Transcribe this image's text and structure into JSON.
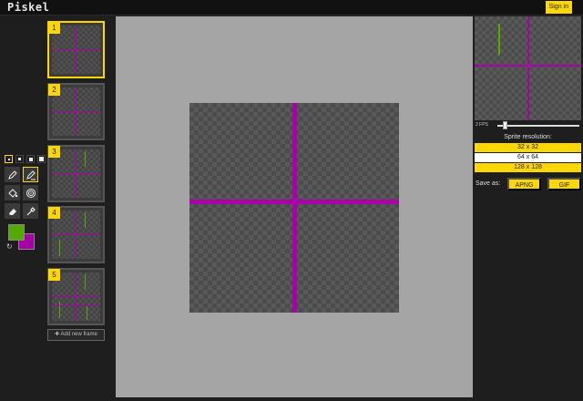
{
  "app": {
    "title": "Piskel",
    "signin_label": "Sign in"
  },
  "colors": {
    "accent": "#ffd700",
    "primary_color": "#55aa00",
    "secondary_color": "#aa00aa",
    "cross_color": "#aa00aa",
    "line_color": "#55aa00"
  },
  "tools": {
    "pen_sizes": [
      "pen-size-1",
      "pen-size-2",
      "pen-size-3",
      "pen-size-4"
    ],
    "items": [
      {
        "name": "pen-tool",
        "icon": "pencil-icon"
      },
      {
        "name": "vertical-mirror-pen-tool",
        "icon": "pencil-icon"
      },
      {
        "name": "paint-bucket-tool",
        "icon": "bucket-icon"
      },
      {
        "name": "paint-same-color-tool",
        "icon": "target-icon"
      },
      {
        "name": "eraser-tool",
        "icon": "eraser-icon"
      },
      {
        "name": "color-picker-tool",
        "icon": "eyedropper-icon"
      }
    ]
  },
  "frames": {
    "items": [
      {
        "number": "1"
      },
      {
        "number": "2"
      },
      {
        "number": "3"
      },
      {
        "number": "4"
      },
      {
        "number": "5"
      }
    ],
    "add_label": "Add new frame"
  },
  "preview": {
    "fps_label": "2 FPS",
    "fps_value": 2
  },
  "resolution": {
    "title": "Sprite resolution:",
    "options": [
      "32 x 32",
      "64 x 64",
      "128 x 128"
    ],
    "selected": "64 x 64"
  },
  "save": {
    "label": "Save as:",
    "apng_label": "APNG",
    "gif_label": "GIF"
  }
}
